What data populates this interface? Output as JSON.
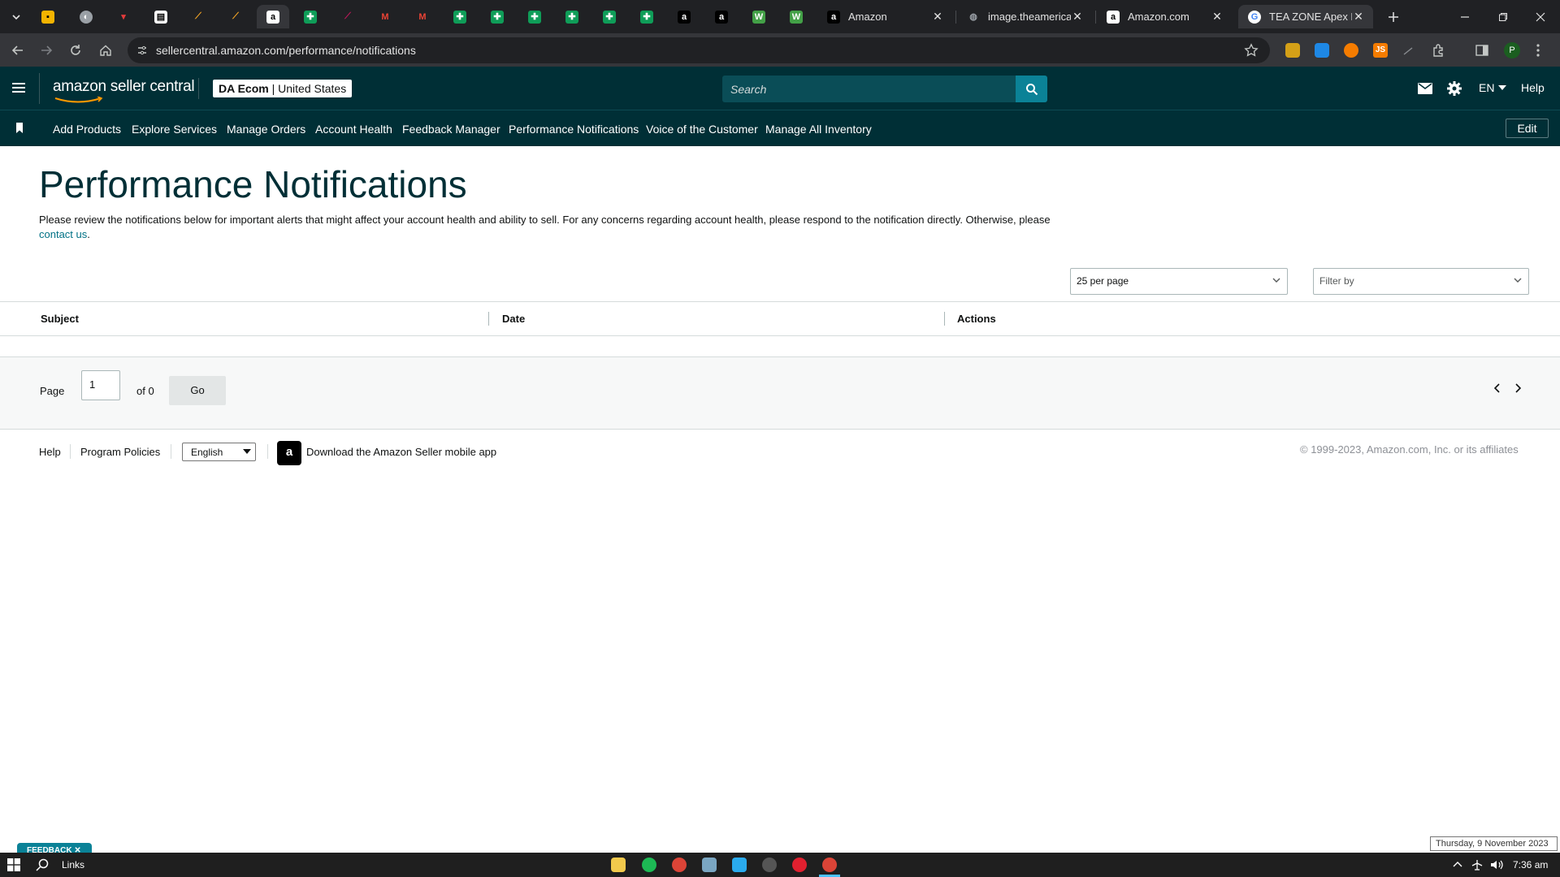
{
  "browser": {
    "tabs": [
      {
        "title": "Amazon",
        "active": false
      },
      {
        "title": "image.theamerican",
        "active": false
      },
      {
        "title": "Amazon.com",
        "active": false
      },
      {
        "title": "TEA ZONE Apex P",
        "active": true
      }
    ],
    "url": "sellercentral.amazon.com/performance/notifications",
    "profile_initial": "P",
    "extension_text": "JS"
  },
  "header": {
    "logo_text": "amazon seller central",
    "store_name": "DA Ecom",
    "marketplace": "United States",
    "search_placeholder": "Search",
    "language": "EN",
    "help_label": "Help"
  },
  "nav": {
    "items": [
      {
        "label": "Add Products"
      },
      {
        "label": "Explore Services"
      },
      {
        "label": "Manage Orders"
      },
      {
        "label": "Account Health"
      },
      {
        "label": "Feedback Manager"
      },
      {
        "label": "Performance Notifications"
      },
      {
        "label": "Voice of the Customer"
      },
      {
        "label": "Manage All Inventory"
      }
    ],
    "edit_label": "Edit"
  },
  "page": {
    "title": "Performance Notifications",
    "description": "Please review the notifications below for important alerts that might affect your account health and ability to sell. For any concerns regarding account health, please respond to the notification directly. Otherwise, please",
    "contact_link": "contact us",
    "contact_suffix": "."
  },
  "controls": {
    "per_page_value": "25 per page",
    "filter_placeholder": "Filter by"
  },
  "table": {
    "columns": [
      "Subject",
      "Date",
      "Actions"
    ],
    "rows": []
  },
  "pager": {
    "page_label": "Page",
    "page_value": "1",
    "of_label": "of 0",
    "go_label": "Go"
  },
  "footer": {
    "help": "Help",
    "program_policies": "Program Policies",
    "language_value": "English",
    "app_link": "Download the Amazon Seller mobile app",
    "copyright": "© 1999-2023, Amazon.com, Inc. or its affiliates"
  },
  "feedback_tab": "FEEDBACK",
  "taskbar": {
    "search_label": "Links",
    "time": "7:36 am",
    "date_tooltip": "Thursday, 9 November 2023"
  },
  "colors": {
    "header_bg": "#002f36",
    "accent": "#007185",
    "search_button": "#0b8297"
  }
}
